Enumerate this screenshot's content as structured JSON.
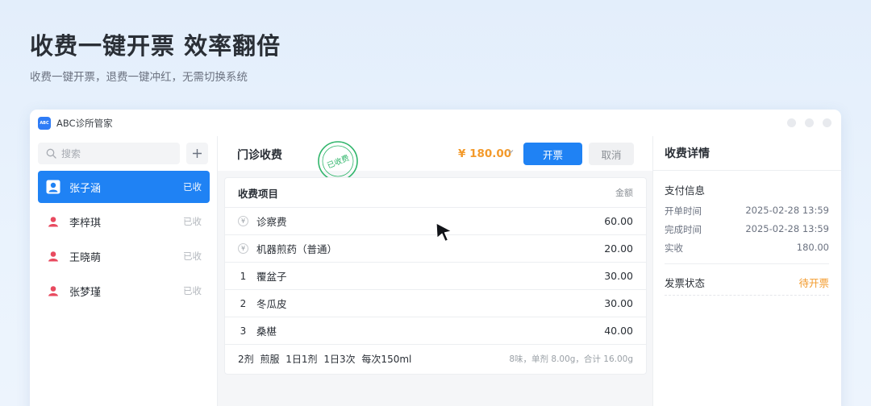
{
  "hero": {
    "title": "收费一键开票 效率翻倍",
    "subtitle": "收费一键开票，退费一键冲红，无需切换系统"
  },
  "window": {
    "logo_text": "ABC",
    "app_title": "ABC诊所管家"
  },
  "sidebar": {
    "search_placeholder": "搜索",
    "patients": [
      {
        "name": "张子涵",
        "status": "已收",
        "active": true
      },
      {
        "name": "李梓琪",
        "status": "已收",
        "active": false
      },
      {
        "name": "王晓萌",
        "status": "已收",
        "active": false
      },
      {
        "name": "张梦瑾",
        "status": "已收",
        "active": false
      }
    ]
  },
  "main": {
    "title": "门诊收费",
    "stamp_text": "已收费",
    "amount": "¥ 180.00",
    "invoice_button": "开票",
    "cancel_button": "取消",
    "table": {
      "header_title": "收费项目",
      "header_amount": "金额",
      "items": [
        {
          "marker": "¥",
          "name": "诊察费",
          "value": "60.00"
        },
        {
          "marker": "¥",
          "name": "机器煎药（普通）",
          "value": "20.00"
        },
        {
          "marker": "1",
          "name": "覆盆子",
          "value": "30.00"
        },
        {
          "marker": "2",
          "name": "冬瓜皮",
          "value": "30.00"
        },
        {
          "marker": "3",
          "name": "桑椹",
          "value": "40.00"
        }
      ],
      "prescription_left": "2剂 煎服 1日1剂 1日3次 每次150ml",
      "prescription_right": "8味，单剂 8.00g，合计 16.00g"
    }
  },
  "details": {
    "title": "收费详情",
    "payment_section": "支付信息",
    "order_time_label": "开单时间",
    "order_time": "2025-02-28 13:59",
    "complete_time_label": "完成时间",
    "complete_time": "2025-02-28 13:59",
    "paid_label": "实收",
    "paid": "180.00",
    "invoice_status_label": "发票状态",
    "invoice_status": "待开票"
  },
  "colors": {
    "primary": "#1f82f4",
    "amount": "#f39a2b",
    "stamp": "#2fb56a",
    "patient_icon": "#e84a5f"
  }
}
